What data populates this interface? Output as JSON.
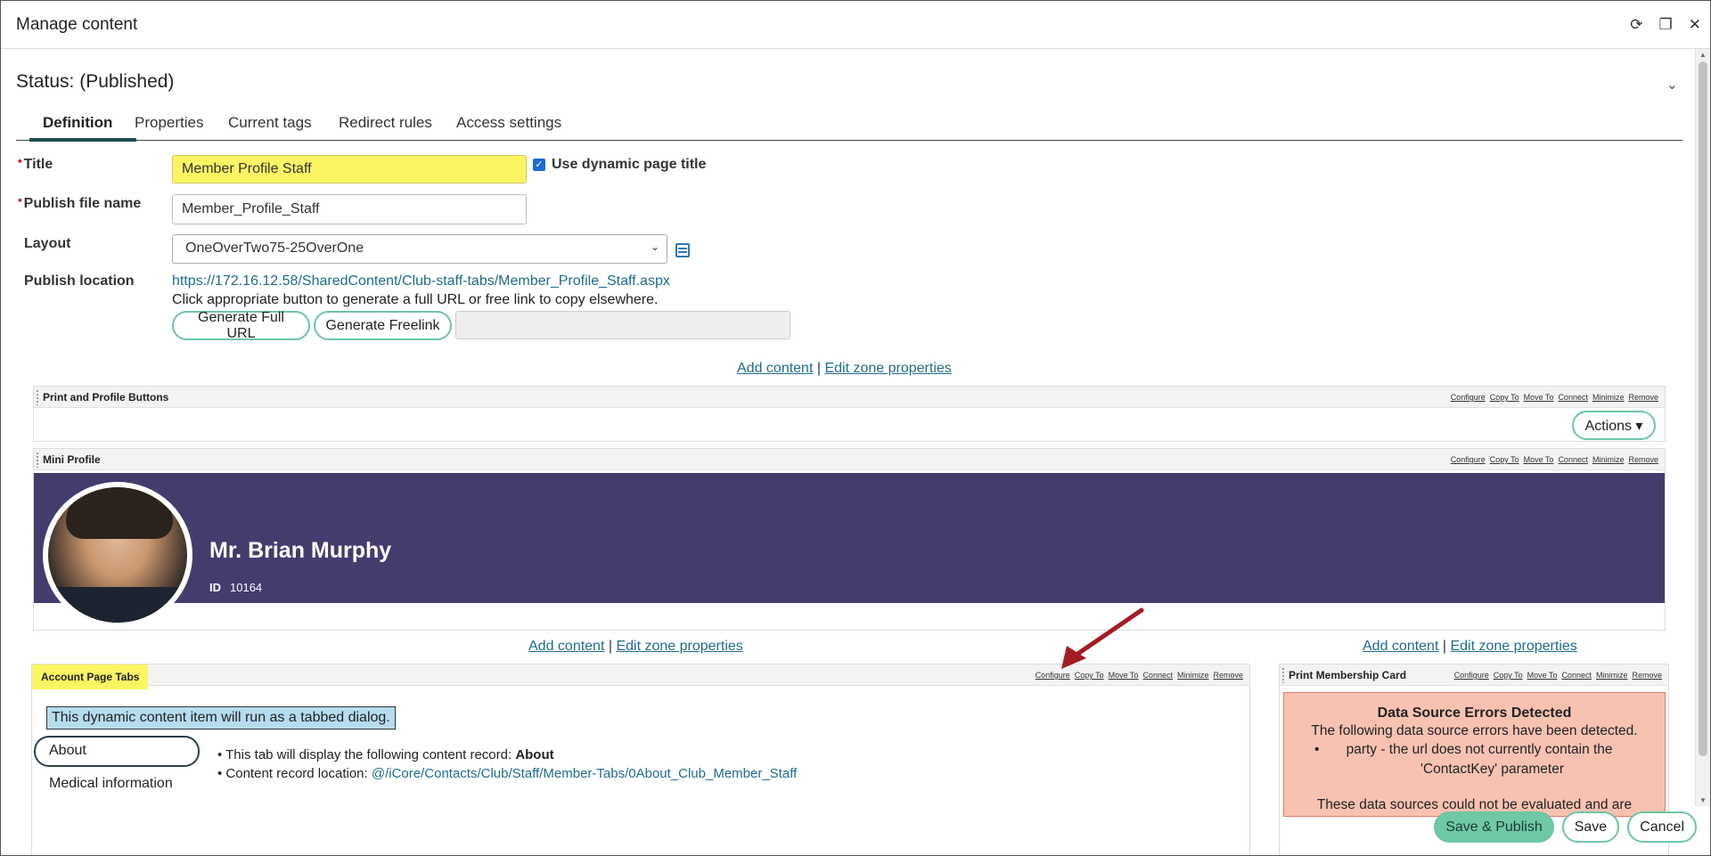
{
  "window": {
    "title": "Manage content",
    "controls": [
      "refresh",
      "restore",
      "close"
    ]
  },
  "status": "Status: (Published)",
  "tabs": [
    {
      "label": "Definition",
      "active": true
    },
    {
      "label": "Properties",
      "active": false
    },
    {
      "label": "Current tags",
      "active": false
    },
    {
      "label": "Redirect rules",
      "active": false
    },
    {
      "label": "Access settings",
      "active": false
    }
  ],
  "form": {
    "title_label": "Title",
    "title_value": "Member Profile Staff",
    "dynamic_title_label": "Use dynamic page title",
    "dynamic_title_checked": true,
    "publish_file_label": "Publish file name",
    "publish_file_value": "Member_Profile_Staff",
    "layout_label": "Layout",
    "layout_value": "OneOverTwo75-25OverOne",
    "publish_location_label": "Publish location",
    "publish_url": "https://172.16.12.58/SharedContent/Club-staff-tabs/Member_Profile_Staff.aspx",
    "publish_hint": "Click appropriate button to generate a full URL or free link to copy elsewhere.",
    "generate_full_url": "Generate Full URL",
    "generate_freelink": "Generate Freelink",
    "generated_link_value": ""
  },
  "zone_links": {
    "add_content": "Add content",
    "separator": "|",
    "edit_zone": "Edit zone properties"
  },
  "webpart_actions": [
    "Configure",
    "Copy To",
    "Move To",
    "Connect",
    "Minimize",
    "Remove"
  ],
  "webparts": {
    "print_profile": {
      "title": "Print and Profile Buttons",
      "actions_button": "Actions ▾"
    },
    "mini_profile": {
      "title": "Mini Profile",
      "name": "Mr. Brian Murphy",
      "id_label": "ID",
      "id_value": "10164",
      "banner_color": "#433d6e"
    },
    "account_tabs": {
      "title": "Account Page Tabs",
      "note": "This dynamic content item will run as a tabbed dialog.",
      "tabs": [
        "About",
        "Medical information"
      ],
      "info_line1_prefix": "• This tab will display the following content record: ",
      "info_line1_value": "About",
      "info_line2_prefix": "• Content record location: ",
      "info_line2_value": "@/iCore/Contacts/Club/Staff/Member-Tabs/0About_Club_Member_Staff"
    },
    "membership_card": {
      "title": "Print Membership Card",
      "error_heading": "Data Source Errors Detected",
      "error_text": "The following data source errors have been detected.",
      "error_item_line1": "party - the url does not currently contain the",
      "error_item_line2": "'ContactKey' parameter",
      "error_footer": "These data sources could not be evaluated and are"
    }
  },
  "bottom_actions": {
    "save_publish": "Save & Publish",
    "save": "Save",
    "cancel": "Cancel"
  },
  "colors": {
    "accent": "#6ec5a4",
    "highlight": "#fbf564",
    "link": "#1f6b8e",
    "annotation_arrow": "#a31c24"
  }
}
